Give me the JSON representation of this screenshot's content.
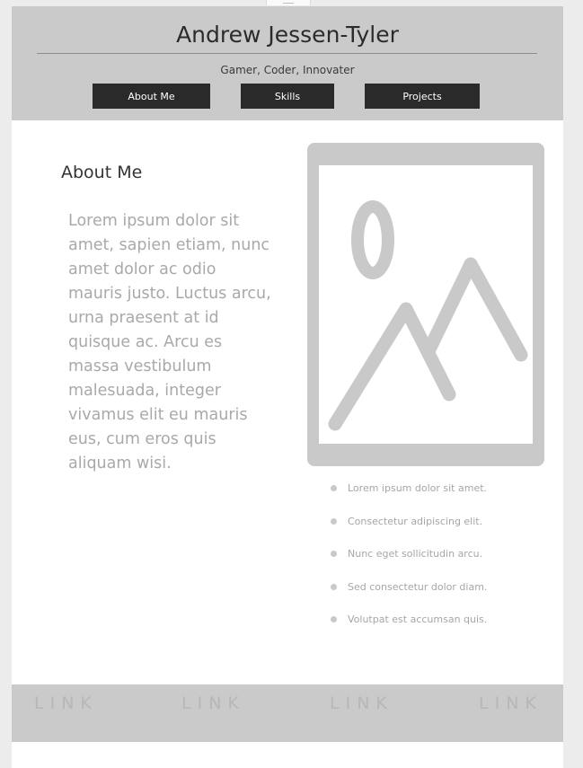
{
  "header": {
    "title": "Andrew Jessen-Tyler",
    "tagline": "Gamer, Coder, Innovater",
    "nav": [
      {
        "label": "About Me"
      },
      {
        "label": "Skills"
      },
      {
        "label": "Projects"
      }
    ]
  },
  "about": {
    "heading": "About Me",
    "body": "Lorem ipsum dolor sit amet, sapien etiam, nunc amet dolor ac odio mauris justo. Luctus arcu, urna praesent at id quisque ac. Arcu es massa vestibulum malesuada, integer vivamus elit eu mauris eus, cum eros quis aliquam wisi."
  },
  "image": {
    "icon": "image-placeholder-icon"
  },
  "bullets": [
    "Lorem ipsum dolor sit amet.",
    "Consectetur adipiscing elit.",
    "Nunc eget sollicitudin arcu.",
    "Sed consectetur dolor diam.",
    "Volutpat est accumsan quis."
  ],
  "footer": {
    "links": [
      "LINK",
      "LINK",
      "LINK",
      "LINK"
    ]
  },
  "colors": {
    "header_bg": "#cacaca",
    "button_bg": "#2a2a2a",
    "page_bg": "#ececec"
  }
}
